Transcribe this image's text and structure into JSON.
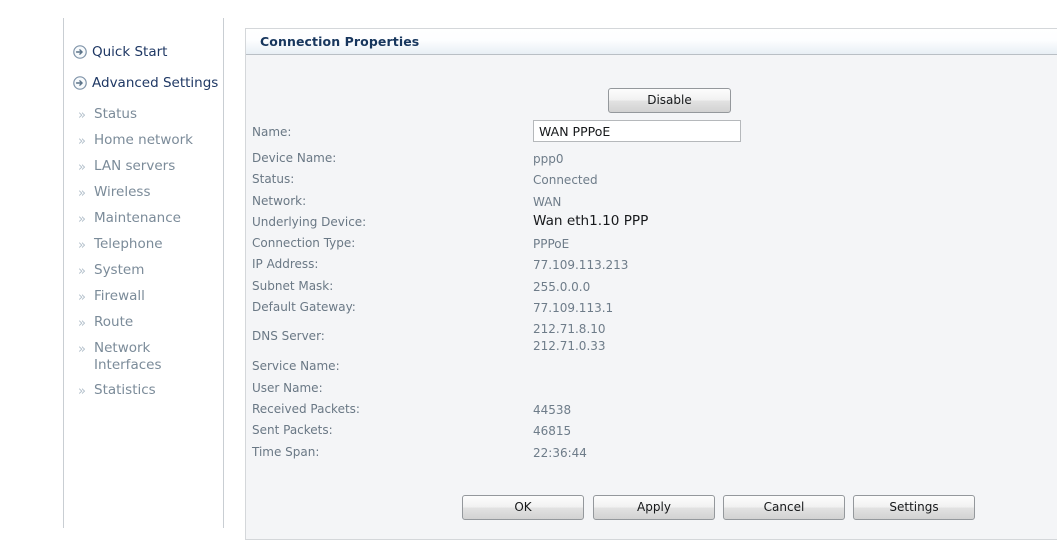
{
  "sidebar": {
    "main_items": [
      {
        "label": "Quick Start",
        "icon": "circle-arrow-icon"
      },
      {
        "label": "Advanced Settings",
        "icon": "circle-arrow-icon"
      }
    ],
    "sub_items": [
      {
        "label": "Status",
        "icon": "double-chevron-icon"
      },
      {
        "label": "Home network",
        "icon": "double-chevron-icon"
      },
      {
        "label": "LAN servers",
        "icon": "double-chevron-icon"
      },
      {
        "label": "Wireless",
        "icon": "double-chevron-icon"
      },
      {
        "label": "Maintenance",
        "icon": "double-chevron-icon"
      },
      {
        "label": "Telephone",
        "icon": "double-chevron-icon"
      },
      {
        "label": "System",
        "icon": "double-chevron-icon"
      },
      {
        "label": "Firewall",
        "icon": "double-chevron-icon"
      },
      {
        "label": "Route",
        "icon": "double-chevron-icon"
      },
      {
        "label": "Network Interfaces",
        "icon": "double-chevron-icon"
      },
      {
        "label": "Statistics",
        "icon": "double-chevron-icon"
      }
    ]
  },
  "panel": {
    "title": "Connection Properties",
    "disable_button": "Disable"
  },
  "form": {
    "name_label": "Name:",
    "name_value": "WAN PPPoE",
    "name_placeholder": "",
    "rows": [
      {
        "label": "Device Name:",
        "value": "ppp0"
      },
      {
        "label": "Status:",
        "value": "Connected"
      },
      {
        "label": "Network:",
        "value": "WAN"
      },
      {
        "label": "Underlying Device:",
        "value": "Wan eth1.10 PPP"
      },
      {
        "label": "Connection Type:",
        "value": "PPPoE"
      },
      {
        "label": "IP Address:",
        "value": "77.109.113.213"
      },
      {
        "label": "Subnet Mask:",
        "value": "255.0.0.0"
      },
      {
        "label": "Default Gateway:",
        "value": "77.109.113.1"
      },
      {
        "label": "DNS Server:",
        "value": "212.71.8.10\n212.71.0.33"
      },
      {
        "label": "Service Name:",
        "value": ""
      },
      {
        "label": "User Name:",
        "value": ""
      },
      {
        "label": "Received Packets:",
        "value": "44538"
      },
      {
        "label": "Sent Packets:",
        "value": "46815"
      },
      {
        "label": "Time Span:",
        "value": "22:36:44"
      }
    ]
  },
  "footer": {
    "buttons": [
      {
        "label": "OK"
      },
      {
        "label": "Apply"
      },
      {
        "label": "Cancel"
      },
      {
        "label": "Settings"
      }
    ]
  },
  "colors": {
    "title": "#17365d",
    "label": "#6a7885",
    "value": "#6e7c89",
    "emphasis": "#17191c",
    "panel_bg": "#f4f5f7",
    "border": "#d4d7da"
  }
}
